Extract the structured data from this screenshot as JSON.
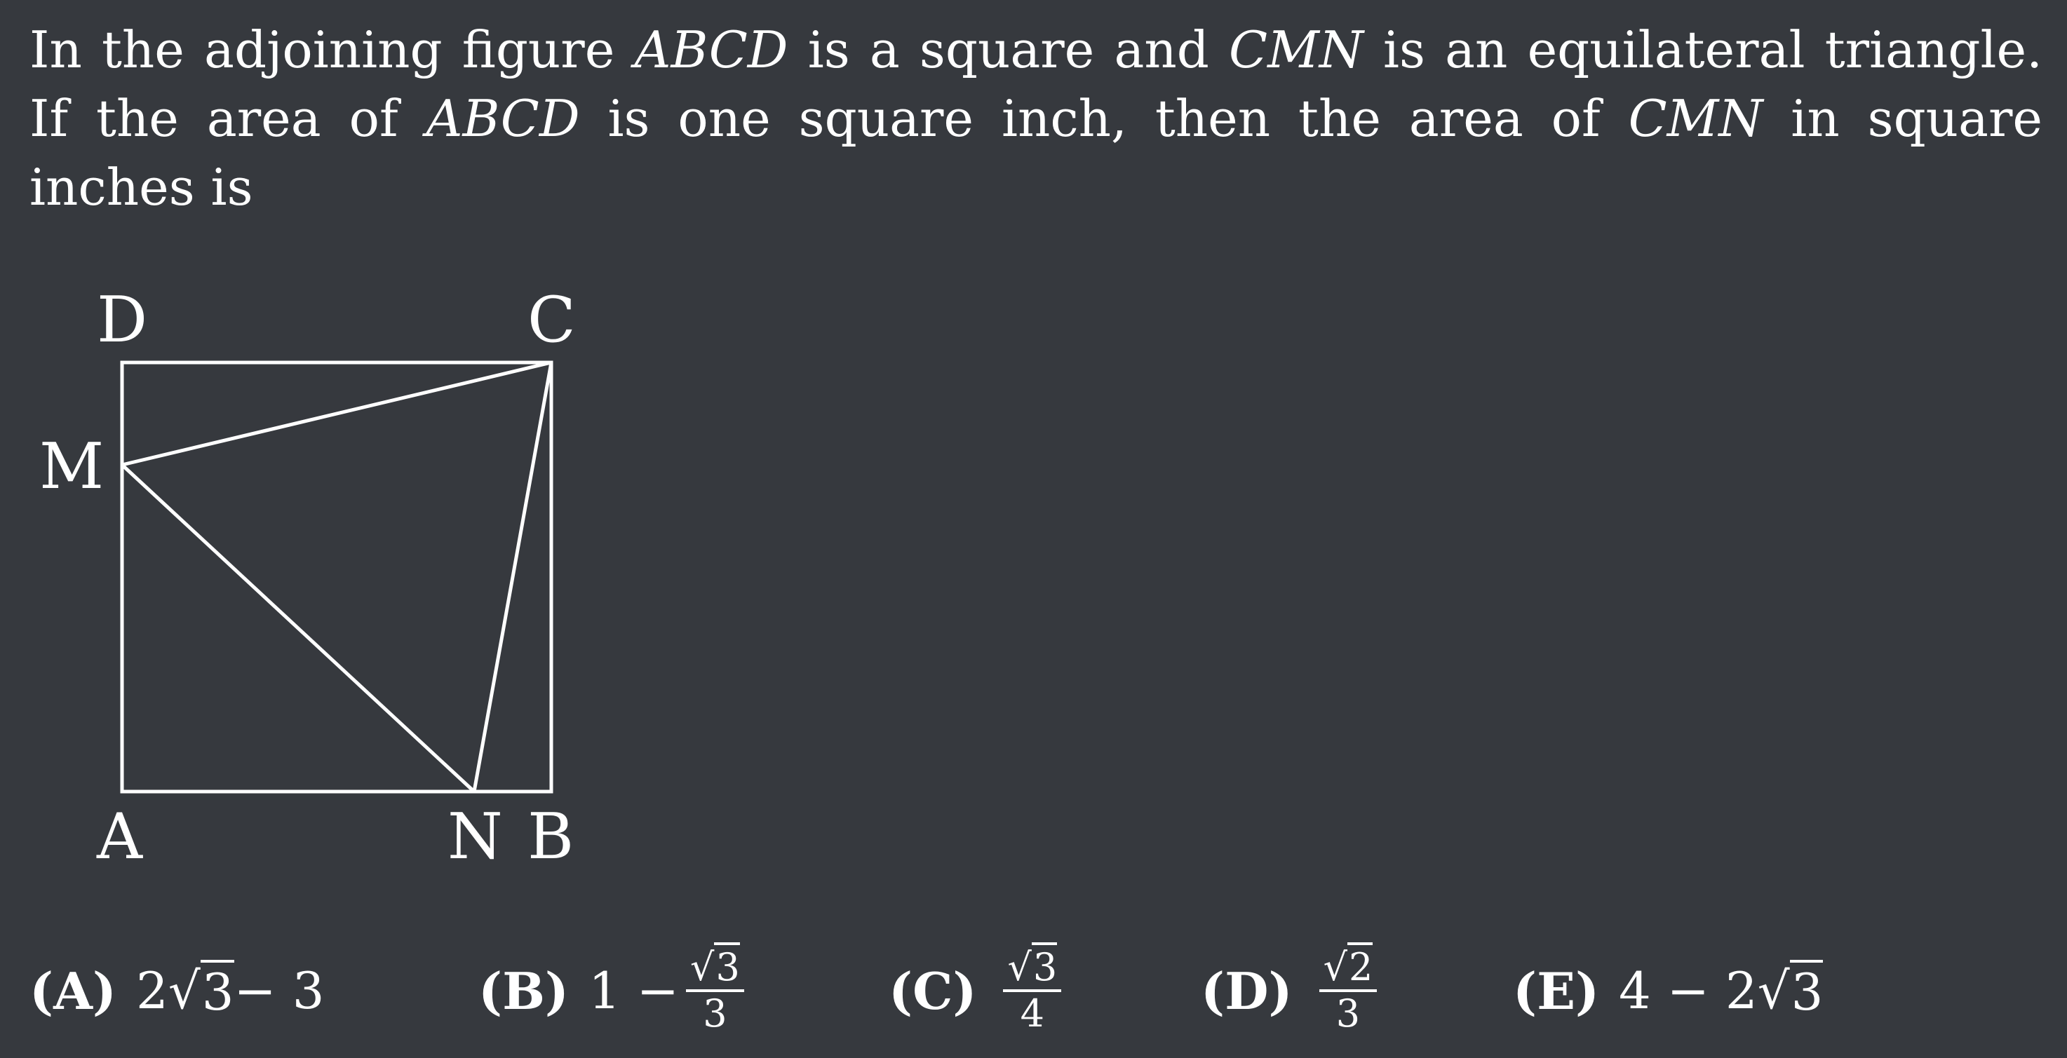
{
  "problem": {
    "t1": "In the adjoining figure ",
    "abcd1": "ABCD",
    "t2": " is a square and ",
    "cmn1": "CMN",
    "t3": " is an equilateral triangle. If the area of ",
    "abcd2": "ABCD",
    "t4": " is one square inch, then the area of ",
    "cmn2": "CMN",
    "t5": " in square inches is"
  },
  "figure": {
    "labels": {
      "D": "D",
      "C": "C",
      "M": "M",
      "A": "A",
      "N": "N",
      "B": "B"
    }
  },
  "choices": [
    {
      "letter": "(A)",
      "a": "2",
      "rad": "3",
      "b": " − 3"
    },
    {
      "letter": "(B)",
      "pre": "1 − ",
      "num_rad": "3",
      "den": "3"
    },
    {
      "letter": "(C)",
      "num_rad": "3",
      "den": "4"
    },
    {
      "letter": "(D)",
      "num_rad": "2",
      "den": "3"
    },
    {
      "letter": "(E)",
      "pre": "4 − 2",
      "rad": "3"
    }
  ]
}
